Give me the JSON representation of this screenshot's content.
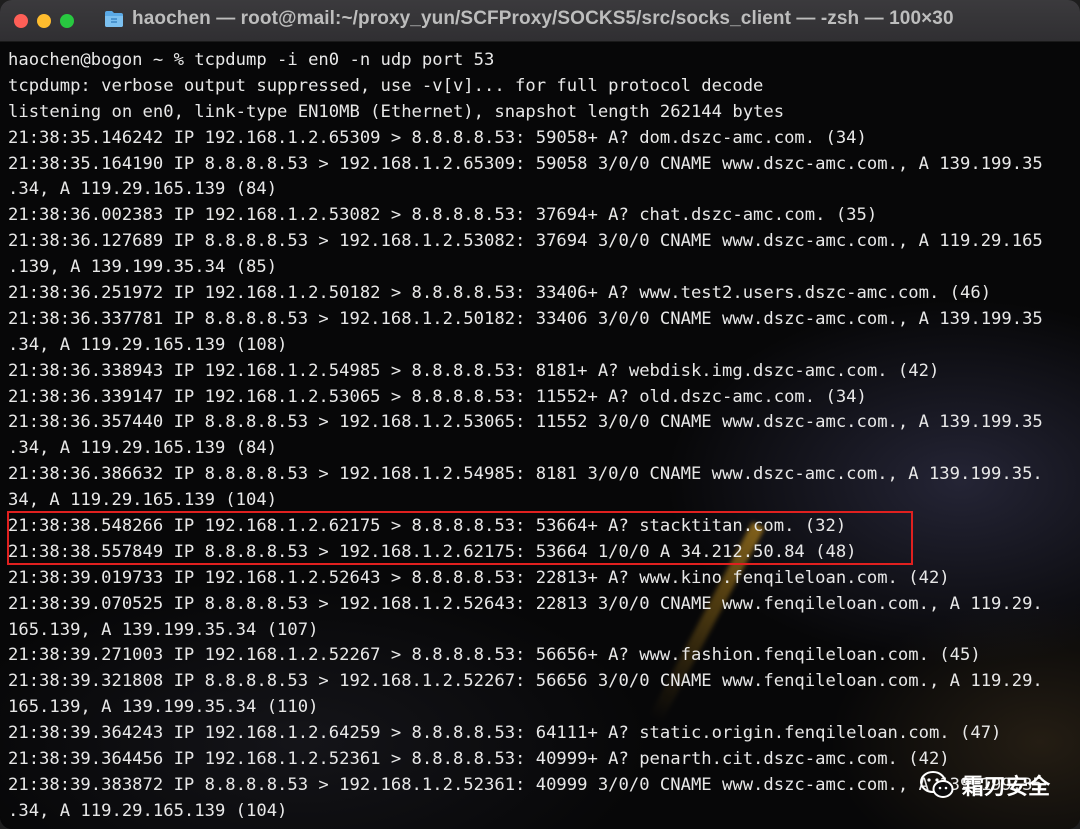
{
  "window": {
    "title": "haochen — root@mail:~/proxy_yun/SCFProxy/SOCKS5/src/socks_client — -zsh — 100×30"
  },
  "terminal": {
    "lines": [
      "haochen@bogon ~ % tcpdump -i en0 -n udp port 53",
      "tcpdump: verbose output suppressed, use -v[v]... for full protocol decode",
      "listening on en0, link-type EN10MB (Ethernet), snapshot length 262144 bytes",
      "21:38:35.146242 IP 192.168.1.2.65309 > 8.8.8.8.53: 59058+ A? dom.dszc-amc.com. (34)",
      "21:38:35.164190 IP 8.8.8.8.53 > 192.168.1.2.65309: 59058 3/0/0 CNAME www.dszc-amc.com., A 139.199.35",
      ".34, A 119.29.165.139 (84)",
      "21:38:36.002383 IP 192.168.1.2.53082 > 8.8.8.8.53: 37694+ A? chat.dszc-amc.com. (35)",
      "21:38:36.127689 IP 8.8.8.8.53 > 192.168.1.2.53082: 37694 3/0/0 CNAME www.dszc-amc.com., A 119.29.165",
      ".139, A 139.199.35.34 (85)",
      "21:38:36.251972 IP 192.168.1.2.50182 > 8.8.8.8.53: 33406+ A? www.test2.users.dszc-amc.com. (46)",
      "21:38:36.337781 IP 8.8.8.8.53 > 192.168.1.2.50182: 33406 3/0/0 CNAME www.dszc-amc.com., A 139.199.35",
      ".34, A 119.29.165.139 (108)",
      "21:38:36.338943 IP 192.168.1.2.54985 > 8.8.8.8.53: 8181+ A? webdisk.img.dszc-amc.com. (42)",
      "21:38:36.339147 IP 192.168.1.2.53065 > 8.8.8.8.53: 11552+ A? old.dszc-amc.com. (34)",
      "21:38:36.357440 IP 8.8.8.8.53 > 192.168.1.2.53065: 11552 3/0/0 CNAME www.dszc-amc.com., A 139.199.35",
      ".34, A 119.29.165.139 (84)",
      "21:38:36.386632 IP 8.8.8.8.53 > 192.168.1.2.54985: 8181 3/0/0 CNAME www.dszc-amc.com., A 139.199.35.",
      "34, A 119.29.165.139 (104)",
      "21:38:38.548266 IP 192.168.1.2.62175 > 8.8.8.8.53: 53664+ A? stacktitan.com. (32)",
      "21:38:38.557849 IP 8.8.8.8.53 > 192.168.1.2.62175: 53664 1/0/0 A 34.212.50.84 (48)",
      "21:38:39.019733 IP 192.168.1.2.52643 > 8.8.8.8.53: 22813+ A? www.kino.fenqileloan.com. (42)",
      "21:38:39.070525 IP 8.8.8.8.53 > 192.168.1.2.52643: 22813 3/0/0 CNAME www.fenqileloan.com., A 119.29.",
      "165.139, A 139.199.35.34 (107)",
      "21:38:39.271003 IP 192.168.1.2.52267 > 8.8.8.8.53: 56656+ A? www.fashion.fenqileloan.com. (45)",
      "21:38:39.321808 IP 8.8.8.8.53 > 192.168.1.2.52267: 56656 3/0/0 CNAME www.fenqileloan.com., A 119.29.",
      "165.139, A 139.199.35.34 (110)",
      "21:38:39.364243 IP 192.168.1.2.64259 > 8.8.8.8.53: 64111+ A? static.origin.fenqileloan.com. (47)",
      "21:38:39.364456 IP 192.168.1.2.52361 > 8.8.8.8.53: 40999+ A? penarth.cit.dszc-amc.com. (42)",
      "21:38:39.383872 IP 8.8.8.8.53 > 192.168.1.2.52361: 40999 3/0/0 CNAME www.dszc-amc.com., A 139.199.35",
      ".34, A 119.29.165.139 (104)"
    ],
    "highlight_color": "#e0201f"
  },
  "watermark": {
    "text": "霜刃安全",
    "icon": "wechat-icon"
  },
  "colors": {
    "close": "#fe5f57",
    "minimize": "#febc2e",
    "zoom": "#28c840",
    "text": "#e8e8e8"
  }
}
